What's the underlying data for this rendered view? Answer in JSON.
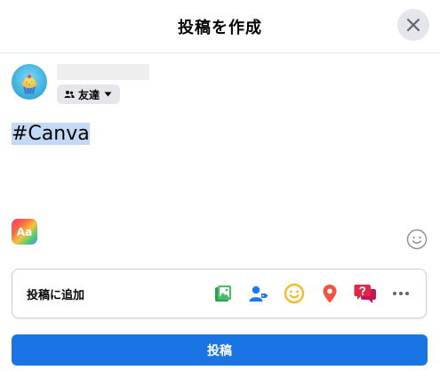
{
  "header": {
    "title": "投稿を作成"
  },
  "user": {
    "audience_label": "友達"
  },
  "composer": {
    "text": "#Canva",
    "text_format_label": "Aa"
  },
  "add_to_post": {
    "label": "投稿に追加",
    "icons": [
      "photo-video-icon",
      "tag-people-icon",
      "feeling-activity-icon",
      "check-in-location-icon",
      "ask-question-icon",
      "more-options-icon"
    ]
  },
  "submit": {
    "label": "投稿"
  },
  "colors": {
    "primary": "#1b74e4",
    "selection": "#c3d9f5",
    "photo_green": "#45bd62",
    "tag_blue": "#1877f2",
    "feeling_yellow": "#f7b928",
    "location_red": "#f5533d",
    "question_red": "#e42645"
  }
}
